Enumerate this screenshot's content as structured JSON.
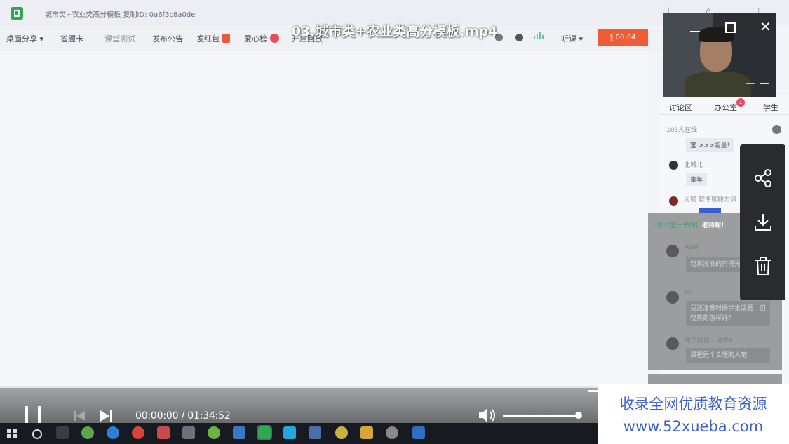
{
  "app": {
    "title": "城市类+农业类高分模板 复制ID: 0a6f3c8a0de"
  },
  "toolbar": {
    "items": [
      "桌面分享 ▾",
      "答题卡",
      "课堂测试",
      "发布公告",
      "发红包",
      "爱心榜",
      "开启回放",
      "听课 ▾"
    ],
    "timer": "‖  00:04"
  },
  "video": {
    "title": "03.城市类+农业类高分模板.mp4"
  },
  "camera_controls": {
    "minimize": "—",
    "close": "✕"
  },
  "right_panel": {
    "tabs": [
      "讨论区",
      "办公室",
      "学生"
    ],
    "office_badge": "1",
    "online": "103人在线",
    "messages": [
      {
        "name": "",
        "text": "莹 >>>能量!"
      },
      {
        "name": "北城北",
        "text": "童年"
      },
      {
        "name": "周班 软件班能力训",
        "text": ""
      }
    ]
  },
  "chat_popup": {
    "tag": "[办公室一书师]",
    "title": "老师呢！",
    "messages": [
      {
        "name": "Aser",
        "text": "我真没准的的得光？"
      },
      {
        "name": "KP",
        "text": "我还注意时候学生话题，但我真的怎样好？"
      },
      {
        "name": "周杰的前 - 课件A",
        "text": "课程是个合理的人吧"
      }
    ]
  },
  "share_panel": {
    "icons": [
      "share-icon",
      "download-icon",
      "trash-icon"
    ]
  },
  "player": {
    "time": "00:00:00 / 01:34:52",
    "volume": 1.0,
    "progress": 0.0
  },
  "watermark": {
    "line1": "收录全网优质教育资源",
    "line2": "www.52xueba.com"
  },
  "colors": {
    "accent_orange": "#f05c36",
    "brand_green": "#2fa84f",
    "watermark_blue": "#3c62c8",
    "taskbar": "#171a21"
  }
}
